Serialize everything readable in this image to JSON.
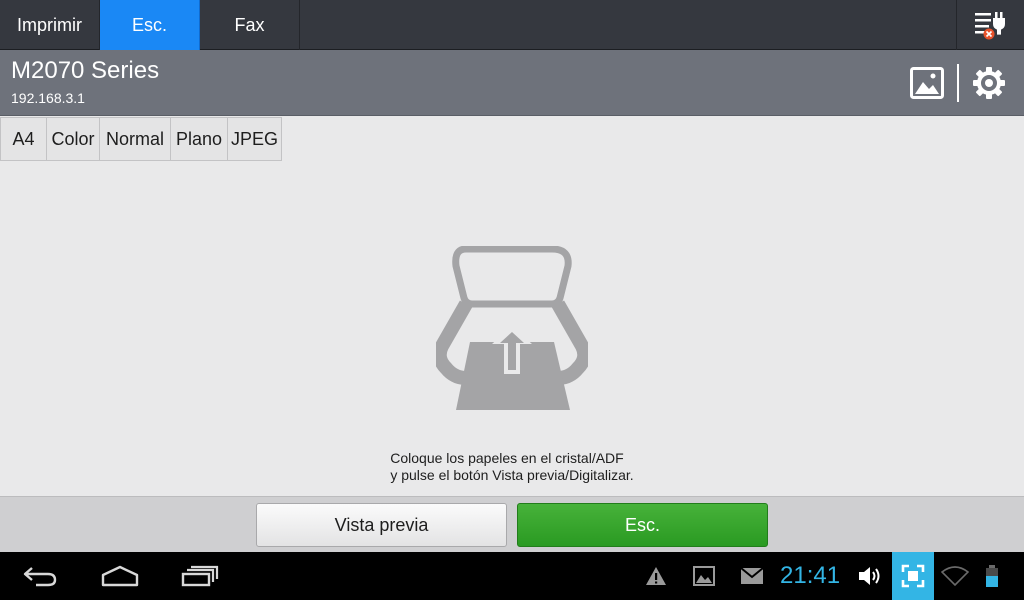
{
  "tabs": [
    {
      "label": "Imprimir",
      "active": false
    },
    {
      "label": "Esc.",
      "active": true
    },
    {
      "label": "Fax",
      "active": false
    }
  ],
  "toolbar": {
    "tool_icon": "settings-plug-icon"
  },
  "device": {
    "name": "M2070 Series",
    "ip": "192.168.3.1"
  },
  "header_icons": {
    "image": "image-icon",
    "settings": "gear-icon"
  },
  "scan_settings": [
    "A4",
    "Color",
    "Normal",
    "Plano",
    "JPEG"
  ],
  "instructions": {
    "line1": "Coloque los papeles en el cristal/ADF",
    "line2": "y pulse el botón Vista previa/Digitalizar."
  },
  "actions": {
    "preview_label": "Vista previa",
    "scan_label": "Esc."
  },
  "system_bar": {
    "clock": "21:41"
  },
  "colors": {
    "accent": "#1a88f5",
    "scan_button": "#2fa127",
    "clock": "#33b5e5"
  }
}
